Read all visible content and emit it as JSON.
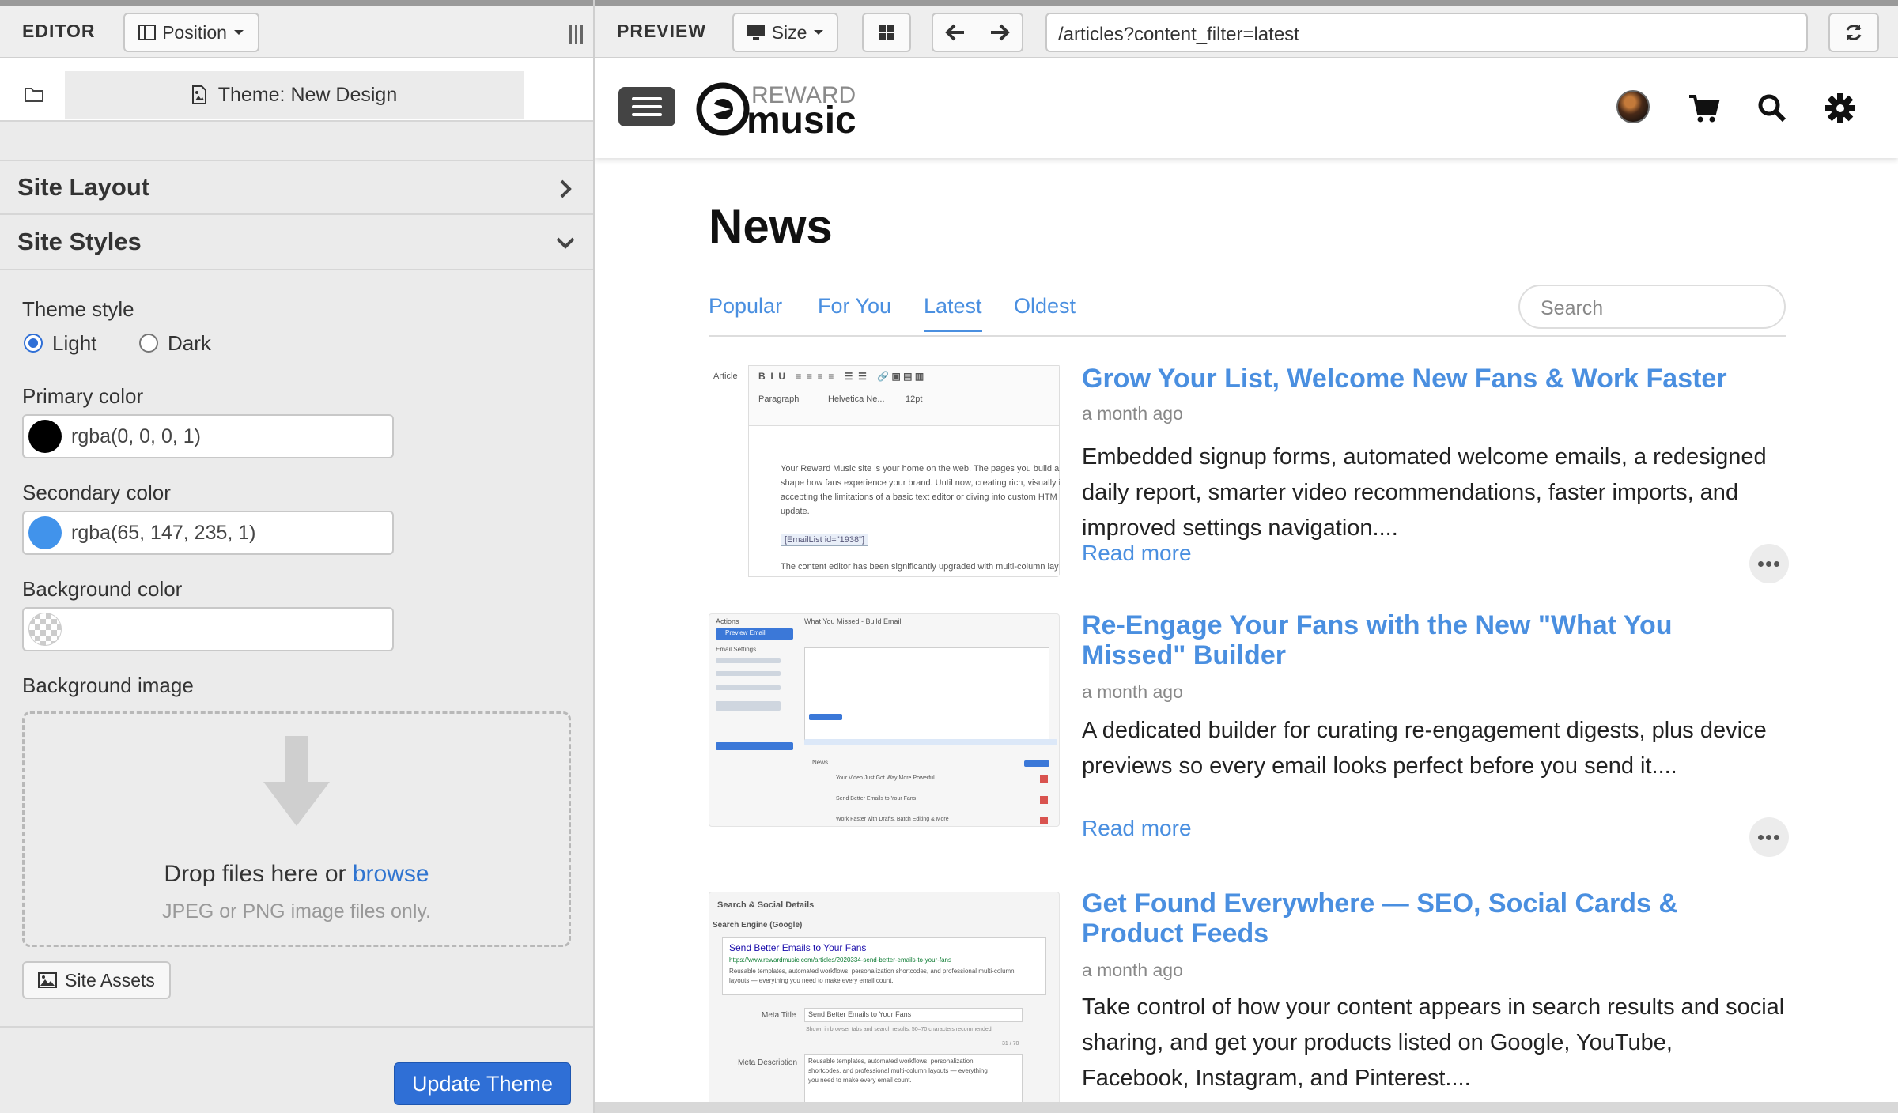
{
  "toolbar": {
    "editor_label": "EDITOR",
    "position_label": "Position",
    "preview_label": "PREVIEW",
    "size_label": "Size",
    "url": "/articles?content_filter=latest"
  },
  "editor": {
    "theme_title": "Theme: New Design",
    "site_layout": "Site Layout",
    "site_styles": "Site Styles",
    "theme_style_label": "Theme style",
    "theme_options": [
      "Light",
      "Dark"
    ],
    "theme_selected": "Light",
    "primary_color_label": "Primary color",
    "primary_color_value": "rgba(0, 0, 0, 1)",
    "primary_color_hex": "#000000",
    "secondary_color_label": "Secondary color",
    "secondary_color_value": "rgba(65, 147, 235, 1)",
    "secondary_color_hex": "#4193eb",
    "background_color_label": "Background color",
    "background_color_value": "",
    "background_image_label": "Background image",
    "drop_text": "Drop files here or",
    "drop_link": "browse",
    "drop_sub": "JPEG or PNG image files only.",
    "site_assets": "Site Assets",
    "update_button": "Update Theme"
  },
  "preview": {
    "logo_top": "REWARD",
    "logo_bottom": "music",
    "page_title": "News",
    "tabs": [
      "Popular",
      "For You",
      "Latest",
      "Oldest"
    ],
    "active_tab": "Latest",
    "search_placeholder": "Search",
    "articles": [
      {
        "title": "Grow Your List, Welcome New Fans & Work Faster",
        "date": "a month ago",
        "description": "Embedded signup forms, automated welcome emails, a redesigned daily report, smarter video recommendations, faster imports, and improved settings navigation....",
        "read_more": "Read more"
      },
      {
        "title": "Re-Engage Your Fans with the New \"What You Missed\" Builder",
        "date": "a month ago",
        "description": "A dedicated builder for curating re-engagement digests, plus device previews so every email looks perfect before you send it....",
        "read_more": "Read more"
      },
      {
        "title": "Get Found Everywhere — SEO, Social Cards & Product Feeds",
        "date": "a month ago",
        "description": "Take control of how your content appears in search results and social sharing, and get your products listed on Google, YouTube, Facebook, Instagram, and Pinterest....",
        "read_more": "Read more"
      }
    ],
    "thumb1": {
      "label": "Article",
      "para": "Paragraph",
      "font": "Helvetica Ne...",
      "size": "12pt",
      "body1": "Your Reward Music site is your home on the web. The pages you build a",
      "body2": "shape how fans experience your brand. Until now, creating rich, visually i",
      "body3": "accepting the limitations of a basic text editor or diving into custom HTM",
      "body4": "update.",
      "code": "[EmailList id=\"1938\"]",
      "body5": "The content editor has been significantly upgraded with multi-column lay"
    },
    "thumb2": {
      "actions": "Actions",
      "heading": "What You Missed - Build Email",
      "preview_btn": "Preview Email",
      "settings": "Email Settings",
      "news": "News",
      "item1": "Your Video Just Got Way More Powerful",
      "item2": "Send Better Emails to Your Fans",
      "item3": "Work Faster with Drafts, Batch Editing & More"
    },
    "thumb3": {
      "heading": "Search & Social Details",
      "engine": "Search Engine (Google)",
      "result_title": "Send Better Emails to Your Fans",
      "result_url": "https://www.rewardmusic.com/articles/2020334-send-better-emails-to-your-fans",
      "result_desc1": "Reusable templates, automated workflows, personalization shortcodes, and professional multi-column",
      "result_desc2": "layouts — everything you need to make every email count.",
      "meta_title_label": "Meta Title",
      "meta_title_value": "Send Better Emails to Your Fans",
      "meta_hint": "Shown in browser tabs and search results. 50–70 characters recommended.",
      "meta_count": "31 / 70",
      "meta_desc_label": "Meta Description",
      "meta_desc_value1": "Reusable templates, automated workflows, personalization",
      "meta_desc_value2": "shortcodes, and professional multi-column layouts — everything",
      "meta_desc_value3": "you need to make every email count."
    }
  }
}
